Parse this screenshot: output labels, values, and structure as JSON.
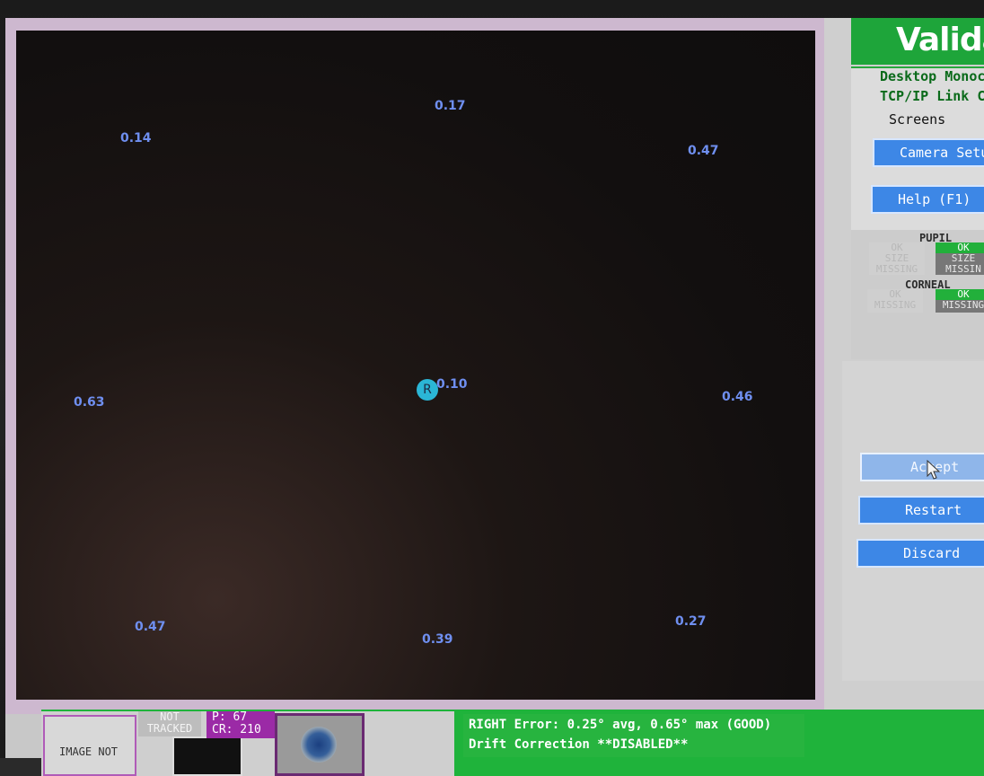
{
  "window": {
    "title": "Valida"
  },
  "mode": {
    "line1": "Desktop Monoc",
    "line2": "TCP/IP Link C"
  },
  "screens": {
    "title": "Screens",
    "camera_setup_label": "Camera Setu",
    "help_label": "Help (F1)"
  },
  "status": {
    "pupil_header": "PUPIL",
    "corneal_header": "CORNEAL",
    "pupil_left": {
      "ok": "OK",
      "size": "SIZE",
      "missing": "MISSING"
    },
    "pupil_right": {
      "ok": "OK",
      "size": "SIZE",
      "missing": "MISSIN"
    },
    "corneal_left": {
      "ok": "OK",
      "missing": "MISSING"
    },
    "corneal_right": {
      "ok": "OK",
      "missing": "MISSING"
    }
  },
  "actions": {
    "accept_label": "Accept",
    "restart_label": "Restart",
    "discard_label": "Discard"
  },
  "targets": [
    {
      "id": "top-left",
      "value": "0.14"
    },
    {
      "id": "top-center",
      "value": "0.17"
    },
    {
      "id": "top-right",
      "value": "0.47"
    },
    {
      "id": "middle-left",
      "value": "0.63"
    },
    {
      "id": "center",
      "value": "0.10"
    },
    {
      "id": "middle-right",
      "value": "0.46"
    },
    {
      "id": "bottom-left",
      "value": "0.47"
    },
    {
      "id": "bottom-center",
      "value": "0.39"
    },
    {
      "id": "bottom-right",
      "value": "0.27"
    }
  ],
  "eye_marker": {
    "label": "R"
  },
  "bottom": {
    "image_not_label": "IMAGE NOT",
    "not_tracked_line1": "NOT",
    "not_tracked_line2": "TRACKED",
    "pupil_line": "P:  67",
    "cr_line": "CR: 210"
  },
  "report": {
    "line1": "RIGHT Error:  0.25° avg,  0.65° max (GOOD)",
    "line2": "Drift Correction **DISABLED**"
  },
  "colors": {
    "target_label": "#6f8ff0",
    "title_green": "#1ea53a",
    "button_blue": "#3d87e6",
    "report_green": "#27b43f",
    "eye_dot": "#2bb6d6"
  }
}
